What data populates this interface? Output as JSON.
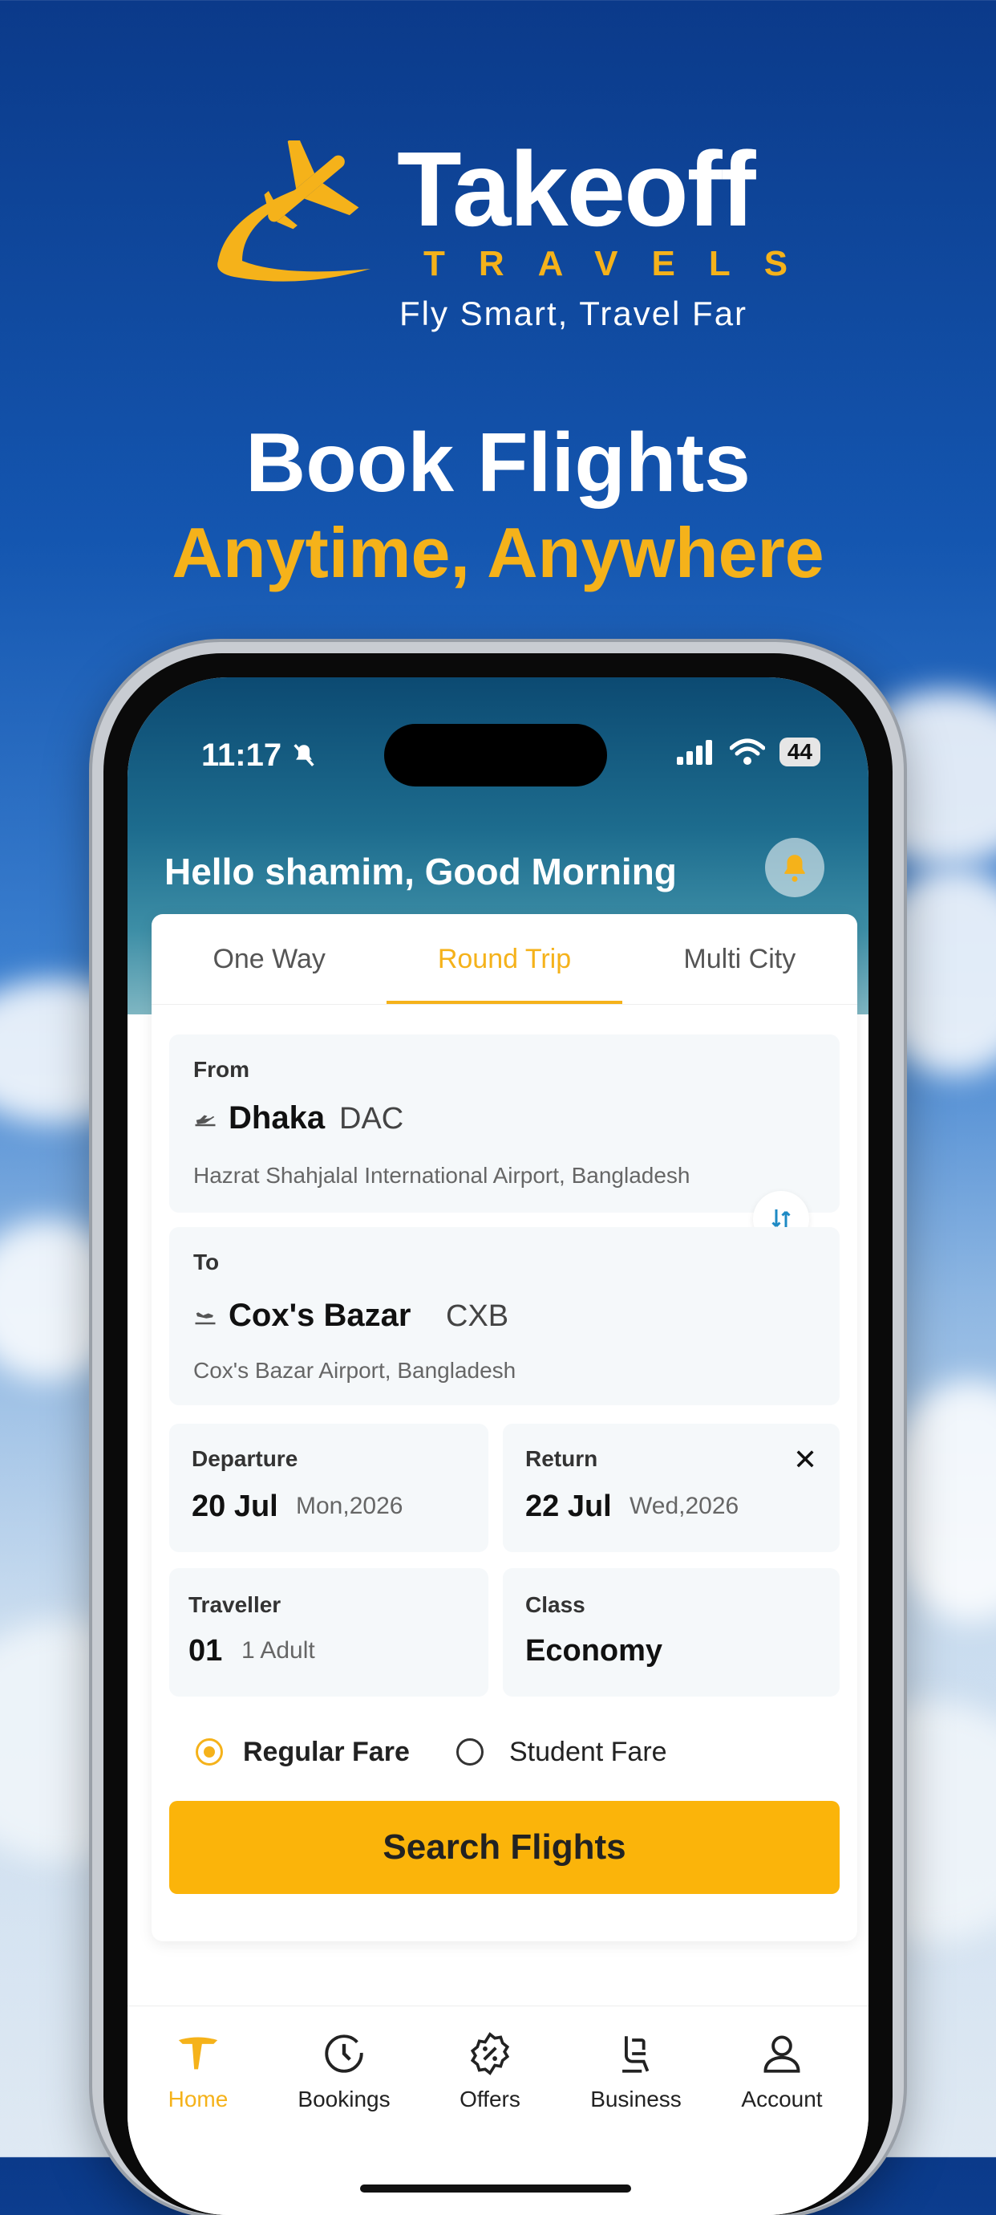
{
  "brand": {
    "name": "Takeoff",
    "sub": "TRAVELS",
    "tagline": "Fly Smart, Travel Far"
  },
  "headline": {
    "line1": "Book Flights",
    "line2": "Anytime, Anywhere"
  },
  "status": {
    "time": "11:17",
    "battery": "44"
  },
  "greeting": "Hello shamim, Good Morning",
  "tabs": [
    {
      "label": "One Way",
      "active": false
    },
    {
      "label": "Round Trip",
      "active": true
    },
    {
      "label": "Multi City",
      "active": false
    }
  ],
  "from": {
    "label": "From",
    "city": "Dhaka",
    "code": "DAC",
    "airport": "Hazrat Shahjalal International Airport, Bangladesh"
  },
  "to": {
    "label": "To",
    "city": "Cox's Bazar",
    "code": "CXB",
    "airport": "Cox's Bazar Airport, Bangladesh"
  },
  "departure": {
    "label": "Departure",
    "date": "20 Jul",
    "day": "Mon,2026"
  },
  "return": {
    "label": "Return",
    "date": "22 Jul",
    "day": "Wed,2026",
    "close": "✕"
  },
  "traveller": {
    "label": "Traveller",
    "count": "01",
    "desc": "1 Adult"
  },
  "class": {
    "label": "Class",
    "value": "Economy"
  },
  "fares": {
    "regular": "Regular Fare",
    "student": "Student Fare",
    "selected": "regular"
  },
  "search_button": "Search Flights",
  "nav": [
    {
      "label": "Home",
      "icon": "home-icon",
      "active": true
    },
    {
      "label": "Bookings",
      "icon": "clock-icon",
      "active": false
    },
    {
      "label": "Offers",
      "icon": "offer-badge-icon",
      "active": false
    },
    {
      "label": "Business",
      "icon": "seat-icon",
      "active": false
    },
    {
      "label": "Account",
      "icon": "user-icon",
      "active": false
    }
  ],
  "colors": {
    "accent": "#f5b21a",
    "button": "#fbb40a",
    "sky_top": "#0b3a8a"
  }
}
